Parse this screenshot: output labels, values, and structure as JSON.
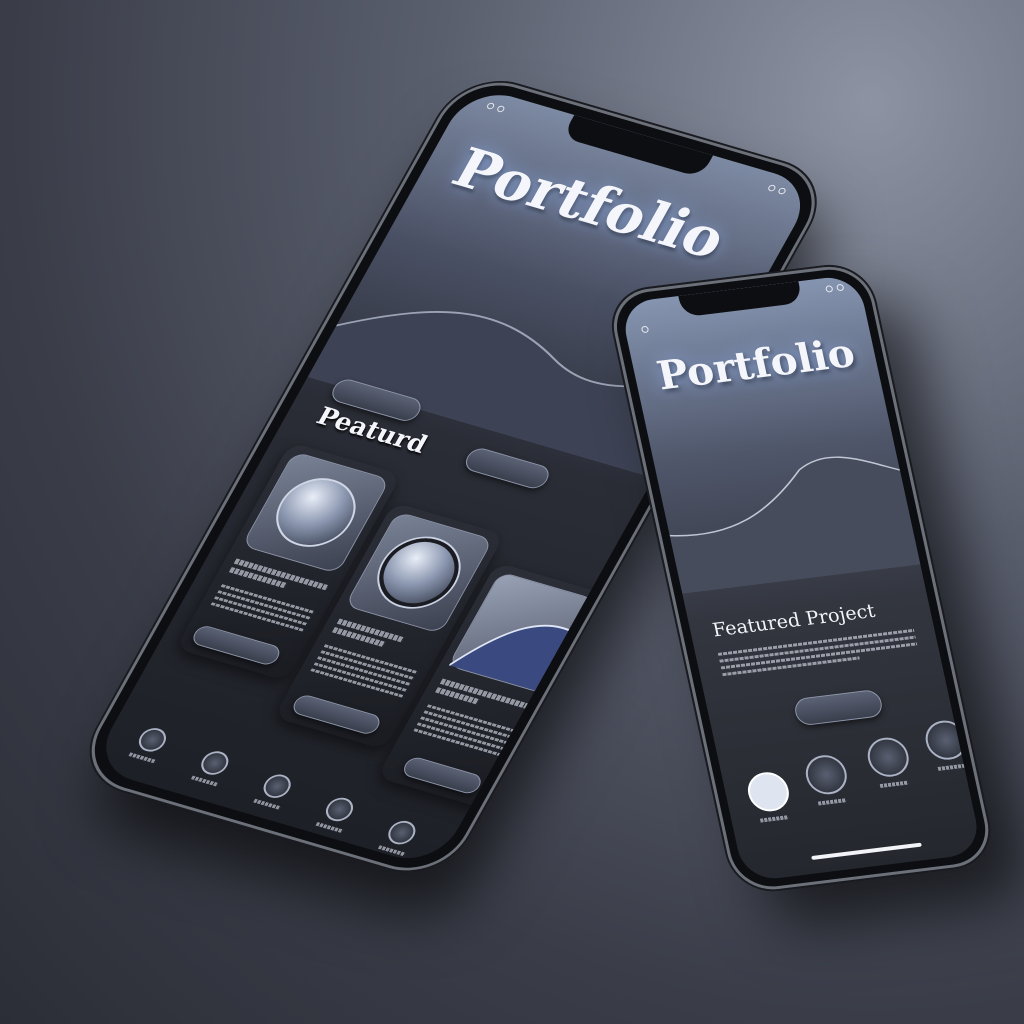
{
  "large_phone": {
    "title": "Portfolio",
    "section_heading": "Peaturd",
    "cards": [
      {
        "icon": "orb-icon"
      },
      {
        "icon": "lens-icon"
      },
      {
        "icon": "wave-image"
      }
    ],
    "nav_icons": [
      "home-icon",
      "profile-icon",
      "camera-icon",
      "bell-icon",
      "settings-icon"
    ]
  },
  "small_phone": {
    "title": "Portfolio",
    "section_heading": "Featured Project",
    "nav_icons": [
      "home-icon",
      "globe-icon",
      "gallery-icon",
      "contact-icon"
    ]
  },
  "colors": {
    "background": "#3a3d48",
    "accent_glow": "#8caae6",
    "screen": "#1e2027"
  }
}
